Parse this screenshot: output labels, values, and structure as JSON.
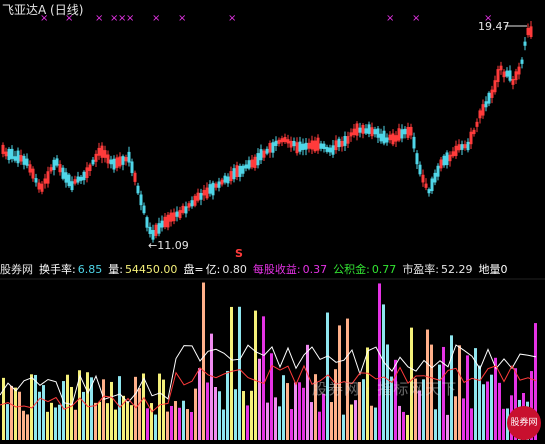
{
  "title": "飞亚达A (日线)",
  "high_marker": "19.47",
  "low_marker": "←11.09",
  "s_marker": "S",
  "cross_marker": "×",
  "info": {
    "site": "股券网",
    "turnover_label": "换手率:",
    "turnover_value": "6.85",
    "volume_label": "量:",
    "volume_value": "54450.00",
    "pan_label": "盘=",
    "yi_label": "亿:",
    "yi_value": "0.80",
    "eps_label": "每股收益:",
    "eps_value": "0.37",
    "reserve_label": "公积金:",
    "reserve_value": "0.77",
    "pe_label": "市盈率:",
    "pe_value": "52.29",
    "dl_label": "地量0"
  },
  "watermark": "股券网 · 指标网天下",
  "logo_text": "股券网",
  "colors": {
    "up": "#ff3b3b",
    "down": "#4fd6e8",
    "magenta": "#e533e5",
    "yellow": "#f5f07a",
    "peach": "#ffb08a",
    "pink": "#f08cf0",
    "lightblue": "#8fe6ef",
    "white": "#ffffff"
  }
}
